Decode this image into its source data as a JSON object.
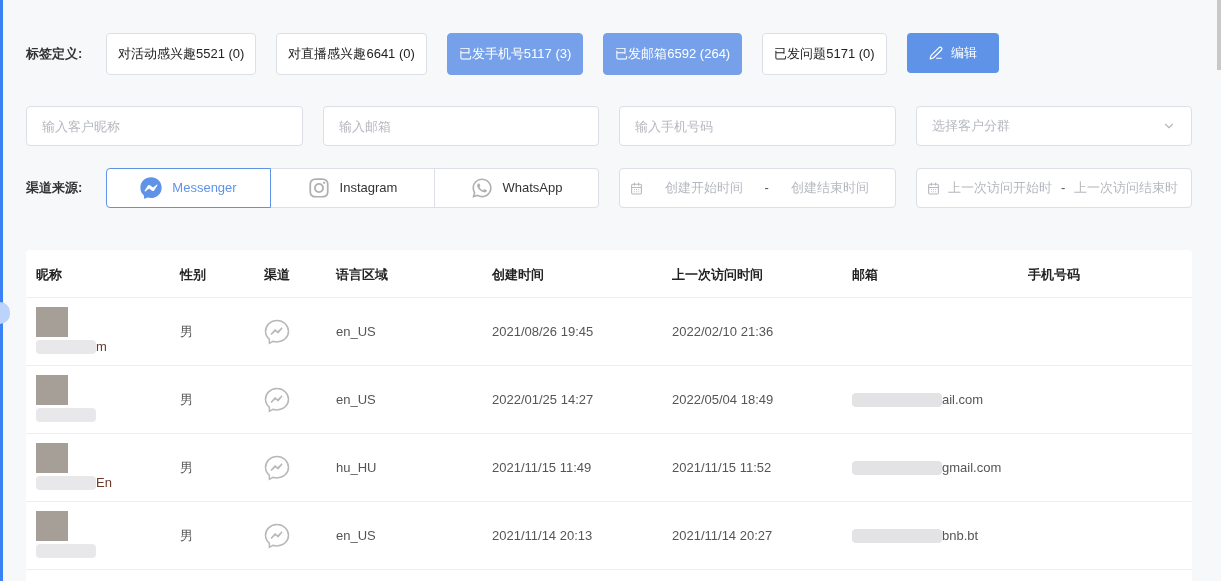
{
  "tag_filter": {
    "label": "标签定义:",
    "tags": [
      {
        "label": "对活动感兴趣5521 (0)",
        "selected": false
      },
      {
        "label": "对直播感兴趣6641 (0)",
        "selected": false
      },
      {
        "label": "已发手机号5117 (3)",
        "selected": true
      },
      {
        "label": "已发邮箱6592 (264)",
        "selected": true
      },
      {
        "label": "已发问题5171 (0)",
        "selected": false
      }
    ],
    "edit_button": "编辑"
  },
  "search_fields": [
    {
      "placeholder": "输入客户昵称"
    },
    {
      "placeholder": "输入邮箱"
    },
    {
      "placeholder": "输入手机号码"
    }
  ],
  "segment_select": {
    "placeholder": "选择客户分群"
  },
  "channel_filter": {
    "label": "渠道来源:",
    "channels": [
      {
        "kind": "messenger",
        "label": "Messenger",
        "selected": true
      },
      {
        "kind": "instagram",
        "label": "Instagram",
        "selected": false
      },
      {
        "kind": "whatsapp",
        "label": "WhatsApp",
        "selected": false
      }
    ]
  },
  "date_ranges": [
    {
      "start": "创建开始时间",
      "separator": "-",
      "end": "创建结束时间"
    },
    {
      "start": "上一次访问开始时",
      "separator": "-",
      "end": "上一次访问结束时"
    }
  ],
  "table": {
    "columns": [
      "昵称",
      "性别",
      "渠道",
      "语言区域",
      "创建时间",
      "上一次访问时间",
      "邮箱",
      "手机号码"
    ],
    "rows": [
      {
        "nickname": "m",
        "gender": "男",
        "kind": "messenger",
        "locale": "en_US",
        "created": "2021/08/26 19:45",
        "last_visit": "2022/02/10 21:36"
      },
      {
        "gender": "男",
        "kind": "messenger",
        "locale": "en_US",
        "created": "2022/01/25 14:27",
        "last_visit": "2022/05/04 18:49",
        "email": "ail.com"
      },
      {
        "nickname": "En",
        "gender": "男",
        "kind": "messenger",
        "locale": "hu_HU",
        "created": "2021/11/15 11:49",
        "last_visit": "2021/11/15 11:52",
        "email": "gmail.com"
      },
      {
        "gender": "男",
        "kind": "messenger",
        "locale": "en_US",
        "created": "2021/11/14 20:13",
        "last_visit": "2021/11/14 20:27",
        "email": "bnb.bt"
      }
    ]
  }
}
